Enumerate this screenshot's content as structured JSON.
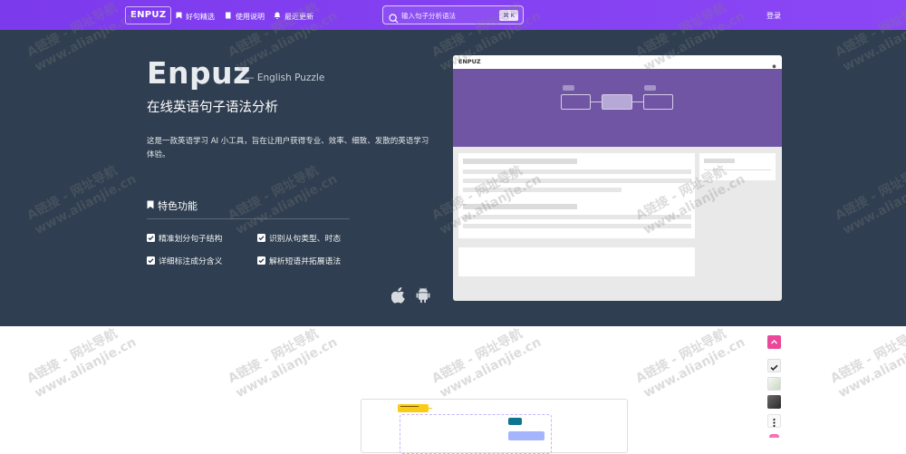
{
  "topbar": {
    "logo": "ENPUZ",
    "nav": [
      "好句精选",
      "使用说明",
      "最近更新"
    ],
    "search_placeholder": "输入句子分析语法",
    "search_shortcut": "⌘ K",
    "login": "登录"
  },
  "hero": {
    "brand": "Enpuz",
    "brand_sub": "— English Puzzle",
    "headline": "在线英语句子语法分析",
    "description": "这是一款英语学习 AI 小工具，旨在让用户获得专业、效率、细致、发散的英语学习体验。",
    "features_title": "特色功能",
    "features": [
      "精准划分句子结构",
      "识别从句类型、时态",
      "详细标注成分含义",
      "解析短语并拓展语法"
    ]
  },
  "preview": {
    "logo": "ENPUZ"
  },
  "watermark": {
    "line1": "A链接 - 网址导航",
    "line2": "www.alianjie.cn"
  },
  "colors": {
    "brand": "#7c3aed",
    "hero_bg": "#2f3e50",
    "preview_band": "#6f55a3"
  },
  "icons": [
    "bookmark-icon",
    "book-icon",
    "bell-icon",
    "search-icon",
    "apple-icon",
    "android-icon",
    "check-icon"
  ]
}
